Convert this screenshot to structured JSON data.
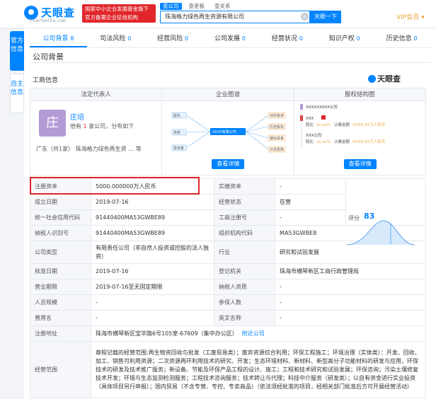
{
  "header": {
    "logo_text": "天眼查",
    "logo_sub": "TianYanCha.com",
    "badge_line1": "国家中小企业发展基金旗下",
    "badge_line2": "官方备案企业征信机构",
    "search_tabs": [
      "查公司",
      "查老板",
      "查关系"
    ],
    "search_value": "珠海格力绿色再生资源有限公司",
    "search_button": "天眼一下",
    "vip_label": "VIP会员 ▾"
  },
  "side_tabs": [
    "官方信息",
    "自主信息"
  ],
  "nav": [
    {
      "label": "公司背景",
      "count": "8"
    },
    {
      "label": "司法风险",
      "count": "0"
    },
    {
      "label": "经营风险",
      "count": "0"
    },
    {
      "label": "公司发展",
      "count": "0"
    },
    {
      "label": "经营状况",
      "count": "0"
    },
    {
      "label": "知识产权",
      "count": "0"
    },
    {
      "label": "历史信息",
      "count": "0"
    }
  ],
  "section_title": "公司背景",
  "sub_title": "工商信息",
  "tyc_mark": "天眼查",
  "cards": {
    "legal_rep_head": "法定代表人",
    "enterprise_map_head": "企业图谱",
    "equity_head": "股权结构图",
    "avatar_char": "庄",
    "legal_name": "庄培",
    "info_prefix": "他有",
    "info_count": "1",
    "info_suffix": "家公司，分布如下",
    "region": "广东（共1家）   珠海格力绿色再生资 … 等",
    "detail_btn": "查看详情",
    "map_labels": [
      "股东",
      "对外投资",
      "高管",
      "XXXX有限公司",
      "投资者",
      "历史股东",
      "疑似关系",
      "分支机构"
    ],
    "equity_top": "XXXXXXXXX公司",
    "equity_xxx": "XXX",
    "equity_ratio_label": "股比",
    "equity_ratio": "xx.xx%",
    "equity_subscribe_label": "认缴金额",
    "equity_subscribe": "XXXX.XX万人民币",
    "equity_xxx_company": "XXX公司"
  },
  "table": {
    "reg_capital_label": "注册资本",
    "reg_capital_value": "5000.000000万人民币",
    "paid_capital_label": "实缴资本",
    "paid_capital_value": "-",
    "score_label": "评分",
    "score_value": "83",
    "est_date_label": "成立日期",
    "est_date_value": "2019-07-16",
    "status_label": "经营状态",
    "status_value": "在营",
    "credit_code_label": "统一社会信用代码",
    "credit_code_value": "91440400MA53GWBE89",
    "reg_no_label": "工商注册号",
    "reg_no_value": "-",
    "tax_id_label": "纳税人识别号",
    "tax_id_value": "91440400MA53GWBE89",
    "org_code_label": "组织机构代码",
    "org_code_value": "MA53GWBE8",
    "company_type_label": "公司类型",
    "company_type_value": "有限责任公司（非自然人投资或控股的法人独资）",
    "industry_label": "行业",
    "industry_value": "研究和试验发展",
    "approval_date_label": "核准日期",
    "approval_date_value": "2019-07-16",
    "reg_authority_label": "登记机关",
    "reg_authority_value": "珠海市横琴新区工商行政管理局",
    "term_label": "营业期限",
    "term_value": "2019-07-16至无固定期限",
    "taxpayer_label": "纳税人资质",
    "taxpayer_value": "-",
    "staff_label": "人员规模",
    "staff_value": "-",
    "insured_label": "参保人数",
    "insured_value": "-",
    "former_name_label": "曾用名",
    "former_name_value": "-",
    "english_name_label": "英文名称",
    "english_name_value": "-",
    "address_label": "注册地址",
    "address_value": "珠海市横琴新区宝华路6号105室-67609（集中办公区）",
    "address_link": "附近公司",
    "scope_label": "经营范围",
    "scope_value": "章程记载的经营范围:再生物资回收与批发（工废贸易类）；废弃资源综合利用；环保工程施工；环境治理（实体类）：开发、回收、加工、销售可利用资源；二次资源再环利用技术的研究、开发；生态环境材料、新材料、新型高分子功能材料的研发与应用，环保技术的研发及技术推广服务；新设备、节能及环保产品工程的设计、施工；工程和技术研究和试验发展；环保咨询；污染土壤修复技术开发；环境与生态监测检测服务；工程技术咨询服务；技术转让与代理；科技中介服务（研发类）；以自有资金进行实业投资（具体项目另行申报）；国内贸易（不含专营、专控、专卖商品）（依法须经批准的项目，经相关部门批准后方可开展经营活动）"
  }
}
